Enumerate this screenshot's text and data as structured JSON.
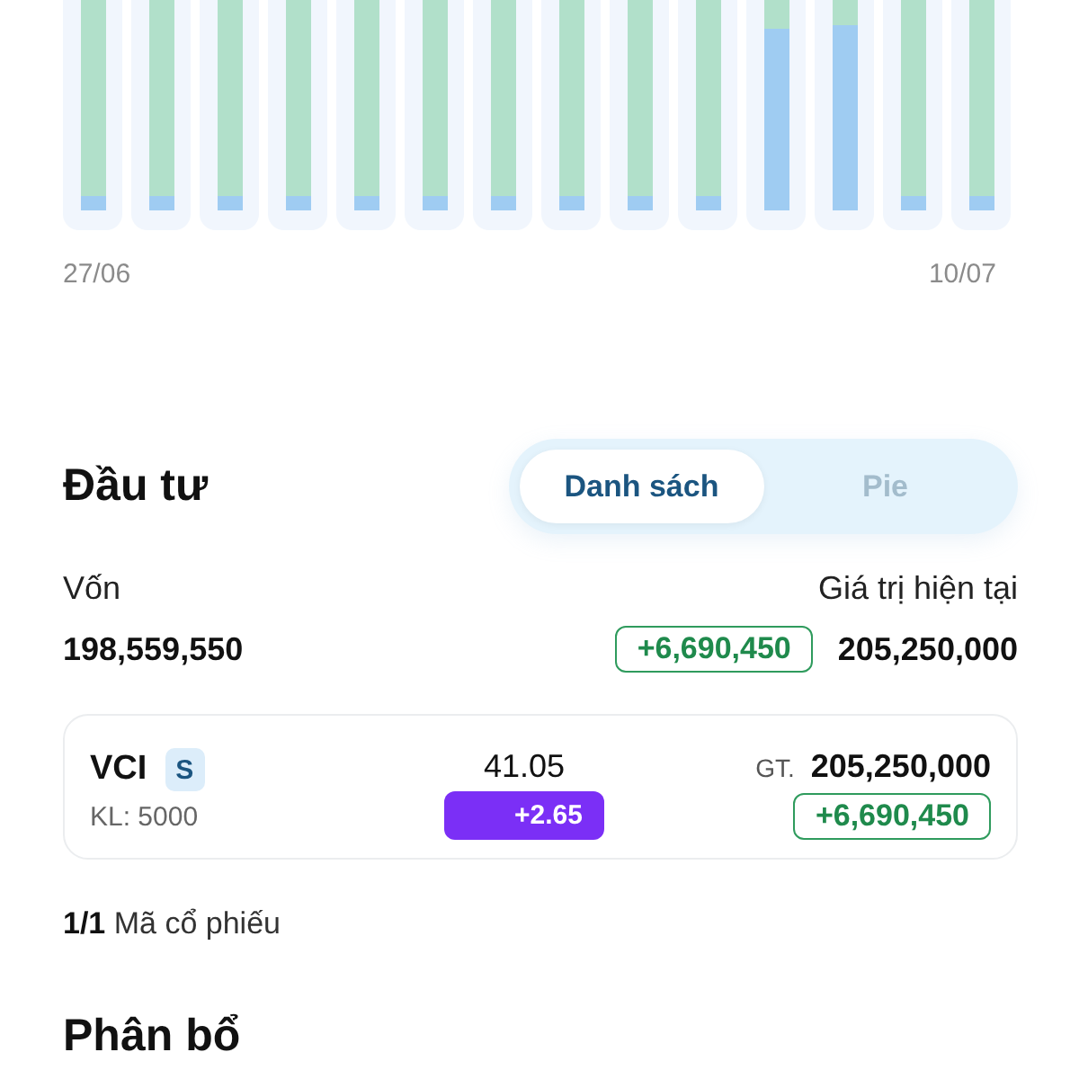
{
  "chart": {
    "start_label": "27/06",
    "end_label": "10/07"
  },
  "investment": {
    "title": "Đầu tư",
    "view_tabs": [
      {
        "label": "Danh sách",
        "selected": true
      },
      {
        "label": "Pie",
        "selected": false
      }
    ],
    "summary": {
      "capital_label": "Vốn",
      "capital": "198,559,550",
      "current_label": "Giá trị hiện tại",
      "change": "+6,690,450",
      "current_value": "205,250,000"
    },
    "holdings": [
      {
        "ticker": "VCI",
        "tag": "S",
        "volume": "KL: 5000",
        "price": "41.05",
        "price_change": "+2.65",
        "value_label": "GT.",
        "value": "205,250,000",
        "profit": "+6,690,450"
      }
    ],
    "count_text": "**1/1** Mã cổ phiếu"
  },
  "allocation": {
    "title": "Phân bổ"
  }
}
